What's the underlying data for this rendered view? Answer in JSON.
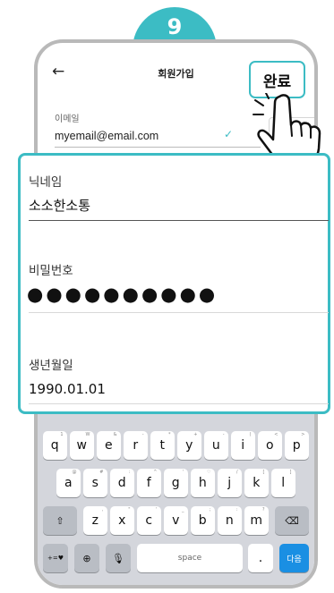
{
  "step": {
    "number": "9"
  },
  "header": {
    "back_icon": "arrow-left-icon",
    "title": "회원가입"
  },
  "done_button": {
    "label": "완료"
  },
  "email": {
    "label": "이메일",
    "value": "myemail@email.com",
    "check_icon": "checkmark-icon"
  },
  "nickname": {
    "label": "닉네임",
    "value": "소소한소통"
  },
  "password": {
    "label": "비밀번호",
    "value": "●●●●●●●●●●"
  },
  "birthdate": {
    "label": "생년월일",
    "value": "1990.01.01"
  },
  "keyboard": {
    "row1": [
      {
        "k": "q",
        "h": "1"
      },
      {
        "k": "w",
        "h": "W"
      },
      {
        "k": "e",
        "h": "&"
      },
      {
        "k": "r",
        "h": "-"
      },
      {
        "k": "t",
        "h": "*"
      },
      {
        "k": "y",
        "h": "+"
      },
      {
        "k": "u",
        "h": "-"
      },
      {
        "k": "i",
        "h": "("
      },
      {
        "k": "o",
        "h": "<"
      },
      {
        "k": "p",
        "h": ">"
      }
    ],
    "row2": [
      {
        "k": "a",
        "h": "@"
      },
      {
        "k": "s",
        "h": "#"
      },
      {
        "k": "d",
        "h": ":"
      },
      {
        "k": "f",
        "h": "^"
      },
      {
        "k": "g",
        "h": "'"
      },
      {
        "k": "h",
        "h": "♡"
      },
      {
        "k": "j",
        "h": "/"
      },
      {
        "k": "k",
        "h": "["
      },
      {
        "k": "l",
        "h": "]"
      }
    ],
    "row3": [
      {
        "k": "z",
        "h": ","
      },
      {
        "k": "x",
        "h": "\""
      },
      {
        "k": "c",
        "h": "'"
      },
      {
        "k": "v",
        "h": "_"
      },
      {
        "k": "b",
        "h": ";"
      },
      {
        "k": "n",
        "h": ":"
      },
      {
        "k": "m",
        "h": "?"
      }
    ],
    "shift_icon": "shift-icon",
    "backspace_icon": "backspace-icon",
    "symbols_label": "+=♥",
    "globe_icon": "globe-icon",
    "mic_icon": "microphone-icon",
    "space_label": "space",
    "period_label": ".",
    "go_label": "다음"
  },
  "colors": {
    "accent": "#3cbcc4",
    "enter_key": "#1a8fe3"
  }
}
